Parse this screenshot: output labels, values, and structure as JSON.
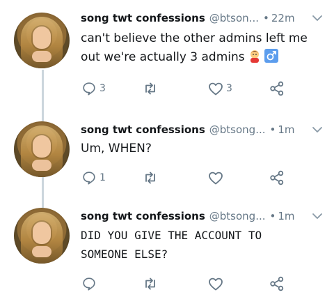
{
  "colors": {
    "name": "#14171a",
    "meta": "#657786",
    "icon": "#657786",
    "thread_line": "#ccd6dd"
  },
  "tweets": [
    {
      "name": "song twt confessions",
      "handle": "@btson...",
      "separator": "•",
      "time": "22m",
      "text": "can't believe the other admins left me out we're actually 3 admins",
      "emoji": [
        "person-gesturing-icon",
        "male-sign-icon"
      ],
      "reply_count": "3",
      "retweet_count": "",
      "like_count": "3"
    },
    {
      "name": "song twt confessions",
      "handle": "@btsong...",
      "separator": "•",
      "time": "1m",
      "text": "Um, WHEN?",
      "reply_count": "1",
      "retweet_count": "",
      "like_count": ""
    },
    {
      "name": "song twt confessions",
      "handle": "@btsong...",
      "separator": "•",
      "time": "1m",
      "text": "DID YOU GIVE THE ACCOUNT TO\nSOMEONE ELSE?",
      "reply_count": "",
      "retweet_count": "",
      "like_count": ""
    }
  ]
}
